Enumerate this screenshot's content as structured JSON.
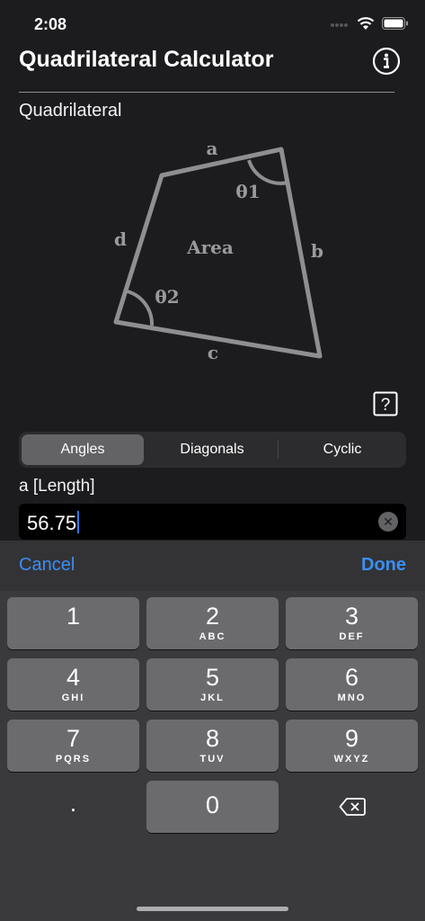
{
  "status": {
    "time": "2:08"
  },
  "header": {
    "title": "Quadrilateral Calculator"
  },
  "section_label": "Quadrilateral",
  "diagram": {
    "side_a": "a",
    "side_b": "b",
    "side_c": "c",
    "side_d": "d",
    "angle1": "θ1",
    "angle2": "θ2",
    "area": "Area"
  },
  "help_label": "?",
  "segmented": {
    "items": [
      "Angles",
      "Diagonals",
      "Cyclic"
    ],
    "selected": "Angles"
  },
  "field": {
    "label": "a [Length]",
    "value": "56.75"
  },
  "keyboard": {
    "cancel": "Cancel",
    "done": "Done",
    "keys": [
      {
        "num": "1",
        "letters": ""
      },
      {
        "num": "2",
        "letters": "ABC"
      },
      {
        "num": "3",
        "letters": "DEF"
      },
      {
        "num": "4",
        "letters": "GHI"
      },
      {
        "num": "5",
        "letters": "JKL"
      },
      {
        "num": "6",
        "letters": "MNO"
      },
      {
        "num": "7",
        "letters": "PQRS"
      },
      {
        "num": "8",
        "letters": "TUV"
      },
      {
        "num": "9",
        "letters": "WXYZ"
      },
      {
        "num": "0",
        "letters": ""
      }
    ],
    "decimal": "."
  },
  "colors": {
    "accent": "#3b8ef5",
    "background": "#1c1c1e",
    "caret": "#3478f6"
  }
}
